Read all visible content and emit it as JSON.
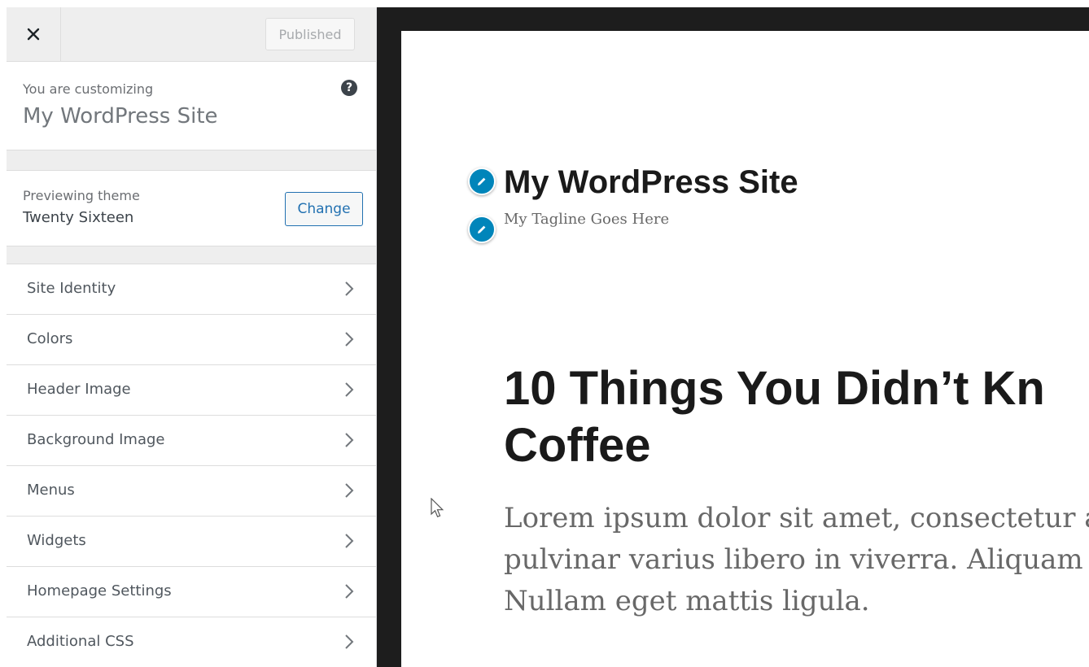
{
  "header": {
    "publish_label": "Published"
  },
  "info": {
    "customizing_label": "You are customizing",
    "site_name": "My WordPress Site",
    "help_glyph": "?"
  },
  "theme": {
    "label": "Previewing theme",
    "name": "Twenty Sixteen",
    "change_label": "Change"
  },
  "sections": [
    {
      "label": "Site Identity"
    },
    {
      "label": "Colors"
    },
    {
      "label": "Header Image"
    },
    {
      "label": "Background Image"
    },
    {
      "label": "Menus"
    },
    {
      "label": "Widgets"
    },
    {
      "label": "Homepage Settings"
    },
    {
      "label": "Additional CSS"
    }
  ],
  "preview": {
    "site_title": "My WordPress Site",
    "tagline": "My Tagline Goes Here",
    "post_title_line1": "10 Things You Didn’t Kn",
    "post_title_line2": "Coffee",
    "excerpt_line1": "Lorem ipsum dolor sit amet, consectetur ad",
    "excerpt_line2": "pulvinar varius libero in viverra. Aliquam vi",
    "excerpt_line3": "Nullam eget mattis ligula."
  },
  "colors": {
    "accent": "#2271b1",
    "edit_shortcut": "#0085ba",
    "frame": "#1d1d1d"
  },
  "icons": {
    "close": "close-icon",
    "help": "help-icon",
    "chevron": "chevron-right-icon",
    "edit": "pencil-icon",
    "cursor": "mouse-pointer-icon"
  }
}
